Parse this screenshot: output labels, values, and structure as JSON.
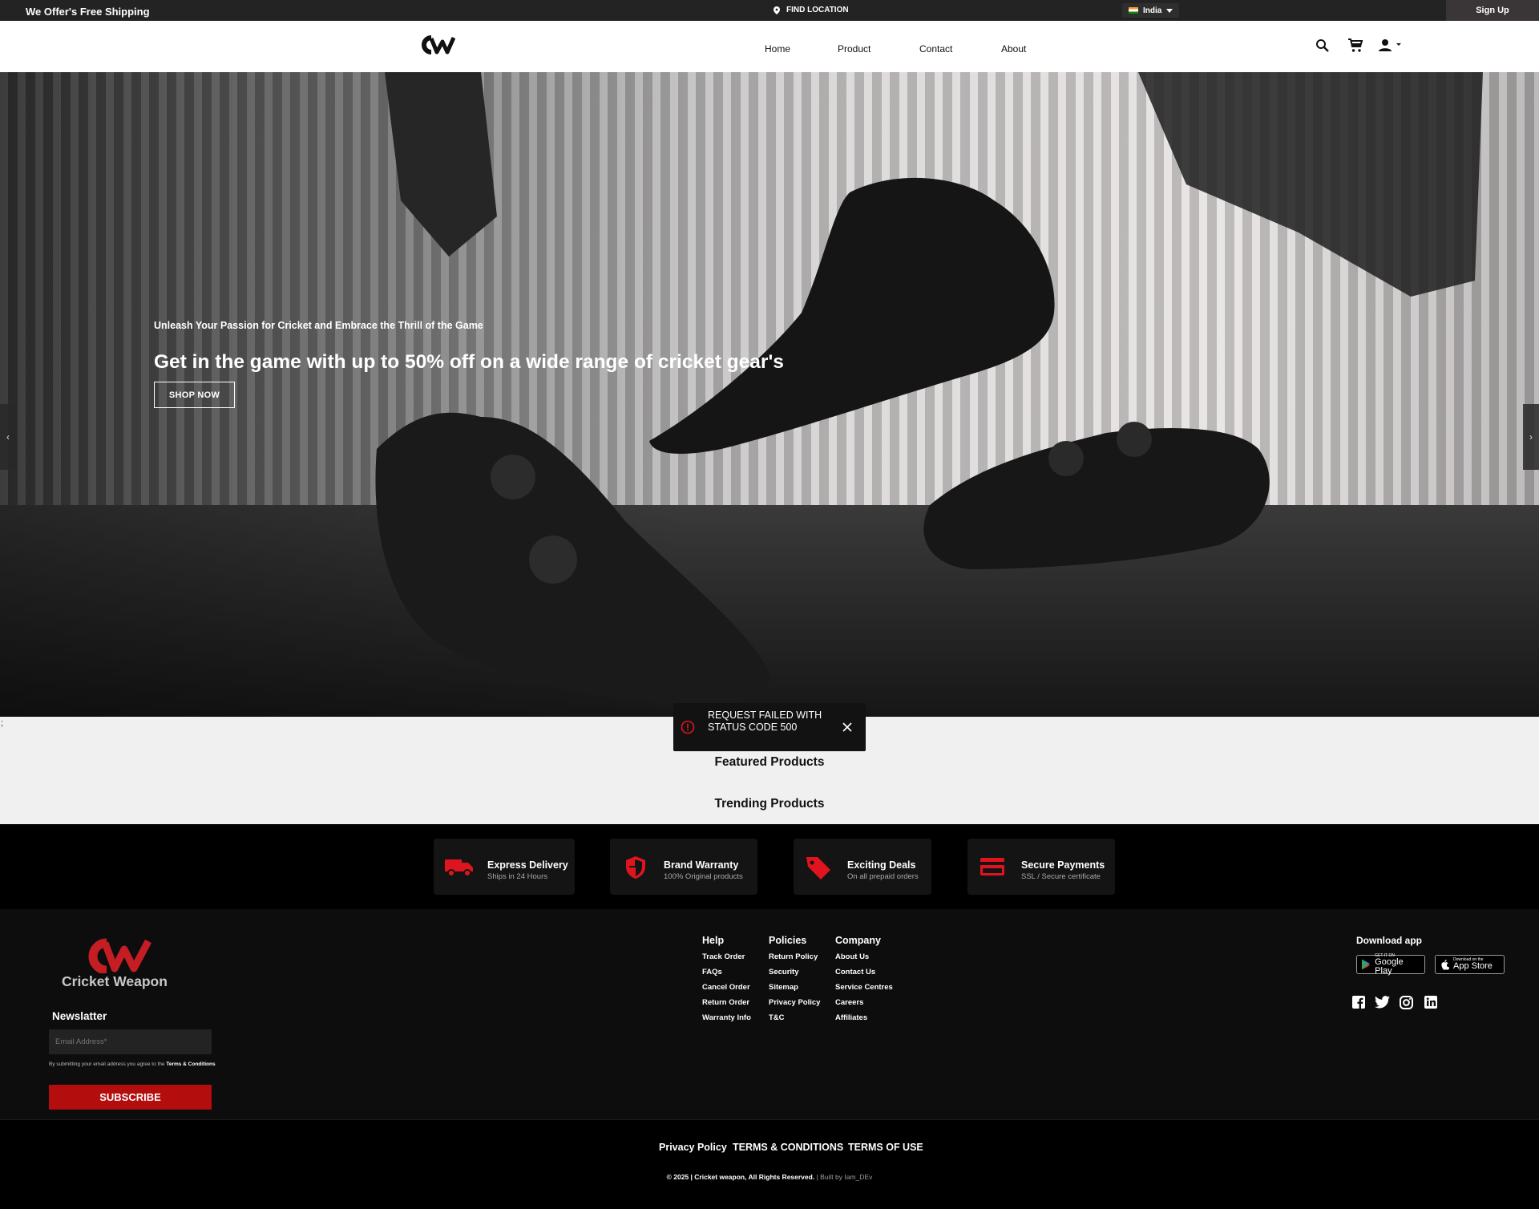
{
  "topbar": {
    "shipping": "We Offer's Free Shipping",
    "location": "FIND LOCATION",
    "country": "India",
    "signup": "Sign Up"
  },
  "nav": {
    "logo": "CW",
    "items": [
      "Home",
      "Product",
      "Contact",
      "About"
    ]
  },
  "hero": {
    "subtitle": "Unleash Your Passion for Cricket and Embrace the Thrill of the Game",
    "headline": "Get in the game with up to 50% off on a wide range of cricket gear's",
    "cta": "SHOP NOW",
    "prev": "‹",
    "next": "›"
  },
  "toast": {
    "message": "REQUEST FAILED WITH STATUS CODE 500"
  },
  "sections": {
    "featured": "Featured Products",
    "trending": "Trending Products",
    "stray": ";"
  },
  "features": [
    {
      "title": "Express Delivery",
      "subtitle": "Ships in 24 Hours",
      "icon": "truck-icon"
    },
    {
      "title": "Brand Warranty",
      "subtitle": "100% Original products",
      "icon": "shield-icon"
    },
    {
      "title": "Exciting Deals",
      "subtitle": "On all prepaid orders",
      "icon": "tag-icon"
    },
    {
      "title": "Secure Payments",
      "subtitle": "SSL / Secure certificate",
      "icon": "card-icon"
    }
  ],
  "footer": {
    "brand": "Cricket Weapon",
    "newsletter_title": "Newslatter",
    "email_placeholder": "Email Address*",
    "consent_text": "By submitting your email address you agree to the",
    "consent_link": "Terms & Conditions",
    "subscribe": "SUBSCRIBE",
    "columns": [
      {
        "title": "Help",
        "links": [
          "Track Order",
          "FAQs",
          "Cancel Order",
          "Return Order",
          "Warranty Info"
        ]
      },
      {
        "title": "Policies",
        "links": [
          "Return Policy",
          "Security",
          "Sitemap",
          "Privacy Policy",
          "T&C"
        ]
      },
      {
        "title": "Company",
        "links": [
          "About Us",
          "Contact Us",
          "Service Centres",
          "Careers",
          "Affiliates"
        ]
      }
    ],
    "download_title": "Download app",
    "google_play": {
      "small": "GET IT ON",
      "big": "Google Play"
    },
    "app_store": {
      "small": "Download on the",
      "big": "App Store"
    },
    "social": [
      "facebook-icon",
      "twitter-icon",
      "instagram-icon",
      "linkedin-icon"
    ]
  },
  "bottom": {
    "privacy": "Privacy Policy",
    "terms": "TERMS & CONDITIONS",
    "use": "TERMS OF USE",
    "copyright": "© 2025 | Cricket weapon, All Rights Reserved.",
    "built": "| Built by Iam_DEv"
  },
  "colors": {
    "accent": "#e0141e",
    "subscribe": "#b30d0d",
    "topbar": "#232323"
  }
}
